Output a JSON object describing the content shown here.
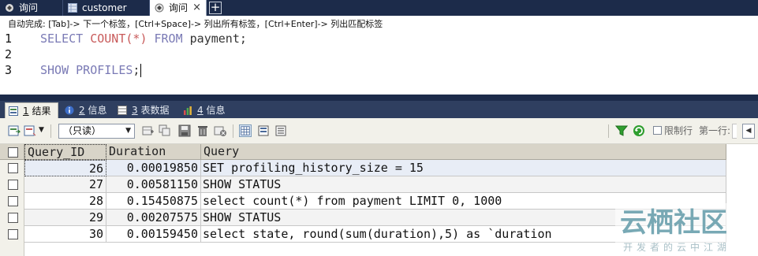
{
  "tabs": [
    {
      "label": "询问",
      "icon": "query-icon",
      "active": false
    },
    {
      "label": "customer",
      "icon": "table-icon",
      "active": false
    },
    {
      "label": "询问",
      "icon": "query-icon",
      "active": true
    }
  ],
  "new_tab_symbol": "+",
  "close_symbol": "×",
  "hint": "自动完成: [Tab]-> 下一个标签，[Ctrl+Space]-> 列出所有标签，[Ctrl+Enter]-> 列出匹配标签",
  "editor": {
    "line_numbers": [
      "1",
      "2",
      "3"
    ],
    "line1": {
      "kw1": "SELECT",
      "fn": "COUNT",
      "open": "(",
      "star": "*",
      "close": ")",
      "kw2": "FROM",
      "table": "payment",
      "end": ";"
    },
    "line3": {
      "kw1": "SHOW",
      "kw2": "PROFILES",
      "end": ";"
    }
  },
  "result_tabs": [
    {
      "num": "1",
      "label": "结果",
      "icon": "result-icon"
    },
    {
      "num": "2",
      "label": "信息",
      "icon": "info-icon"
    },
    {
      "num": "3",
      "label": "表数据",
      "icon": "table-data-icon"
    },
    {
      "num": "4",
      "label": "信息",
      "icon": "chart-info-icon"
    }
  ],
  "toolbar": {
    "readonly_select": "（只读）",
    "limit_label": "限制行",
    "first_row_label": "第一行:"
  },
  "grid": {
    "columns": [
      "Query_ID",
      "Duration",
      "Query"
    ],
    "rows": [
      {
        "id": "26",
        "duration": "0.00019850",
        "query": "SET profiling_history_size = 15"
      },
      {
        "id": "27",
        "duration": "0.00581150",
        "query": "SHOW STATUS"
      },
      {
        "id": "28",
        "duration": "0.15450875",
        "query": "select count(*) from payment LIMIT 0, 1000"
      },
      {
        "id": "29",
        "duration": "0.00207575",
        "query": "SHOW STATUS"
      },
      {
        "id": "30",
        "duration": "0.00159450",
        "query": "select state, round(sum(duration),5) as `duration"
      }
    ]
  },
  "watermark": {
    "title": "云栖社区",
    "subtitle": "开发者的云中江湖"
  },
  "colors": {
    "keyword": "#7a7ab5",
    "function": "#c85a5a",
    "tabbar": "#1c2b4a"
  }
}
